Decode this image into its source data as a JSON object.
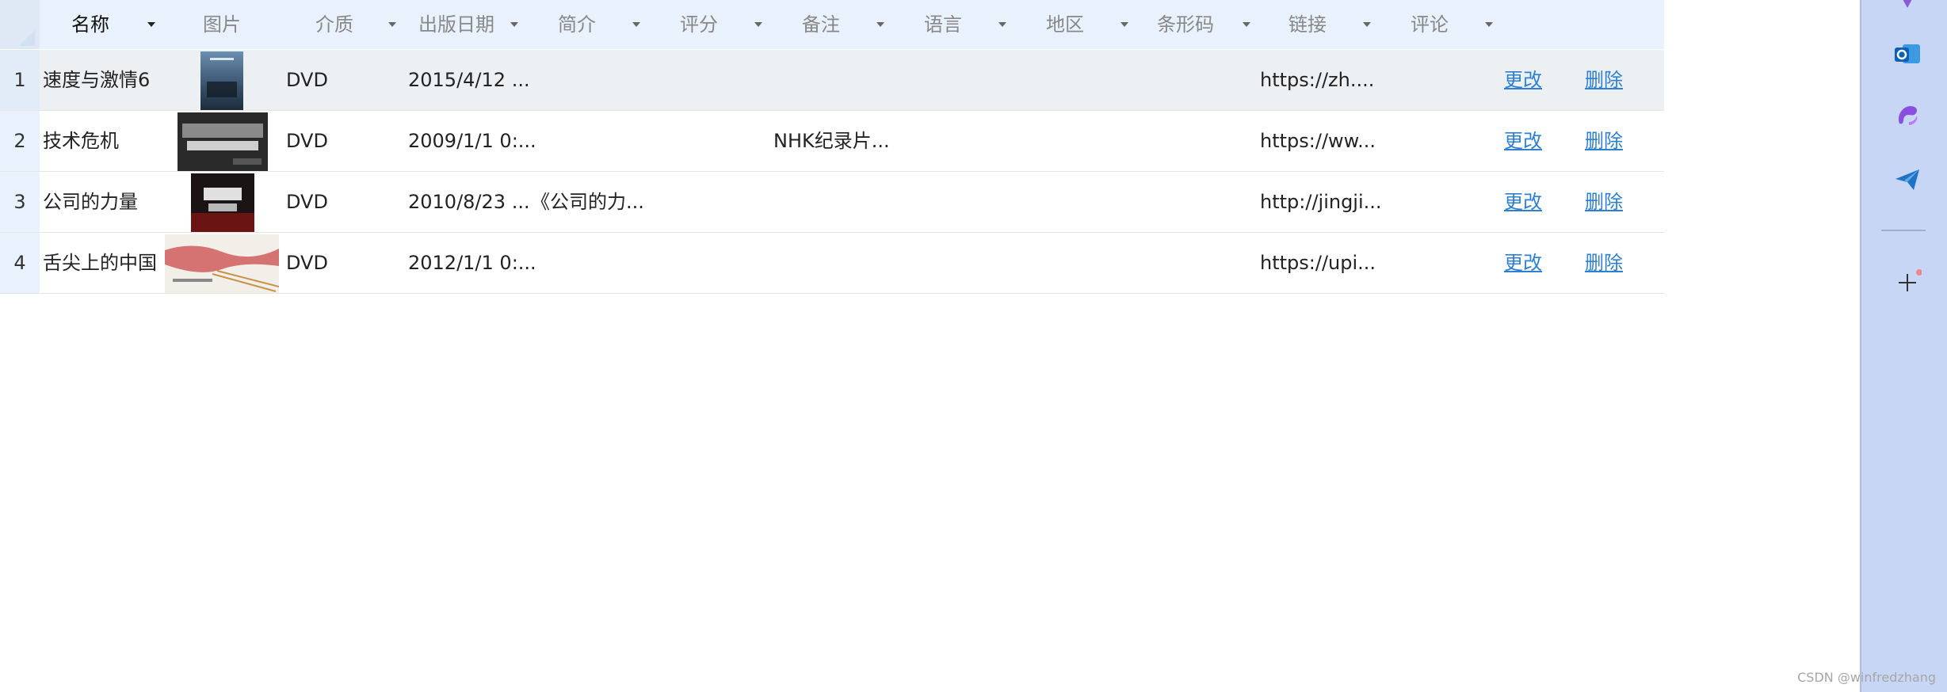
{
  "columns": [
    {
      "label": "名称",
      "has_menu": true
    },
    {
      "label": "图片",
      "has_menu": false
    },
    {
      "label": "介质",
      "has_menu": true
    },
    {
      "label": "出版日期",
      "has_menu": true
    },
    {
      "label": "简介",
      "has_menu": true
    },
    {
      "label": "评分",
      "has_menu": true
    },
    {
      "label": "备注",
      "has_menu": true
    },
    {
      "label": "语言",
      "has_menu": true
    },
    {
      "label": "地区",
      "has_menu": true
    },
    {
      "label": "条形码",
      "has_menu": true
    },
    {
      "label": "链接",
      "has_menu": true
    },
    {
      "label": "评论",
      "has_menu": true
    }
  ],
  "rows": [
    {
      "num": "1",
      "name": "速度与激情6",
      "media": "DVD",
      "date": "2015/4/12 ...",
      "intro": "",
      "rating": "",
      "note": "",
      "link": "https://zh....",
      "edit": "更改",
      "delete": "删除",
      "selected": true
    },
    {
      "num": "2",
      "name": "技术危机",
      "media": "DVD",
      "date": "2009/1/1 0:...",
      "intro": "",
      "rating": "",
      "note": "NHK纪录片...",
      "link": "https://ww...",
      "edit": "更改",
      "delete": "删除",
      "selected": false
    },
    {
      "num": "3",
      "name": "公司的力量",
      "media": "DVD",
      "date": "2010/8/23 ...",
      "intro": "《公司的力...",
      "rating": "",
      "note": "",
      "link": "http://jingji...",
      "edit": "更改",
      "delete": "删除",
      "selected": false
    },
    {
      "num": "4",
      "name": "舌尖上的中国",
      "media": "DVD",
      "date": "2012/1/1 0:...",
      "intro": "",
      "rating": "",
      "note": "",
      "link": "https://upi...",
      "edit": "更改",
      "delete": "删除",
      "selected": false
    }
  ],
  "sidebar": {
    "icons": [
      "apps-icon",
      "outlook-icon",
      "copilot-icon",
      "send-icon",
      "add-icon"
    ],
    "accent": "#2f80d0"
  },
  "watermark": "CSDN @winfredzhang"
}
